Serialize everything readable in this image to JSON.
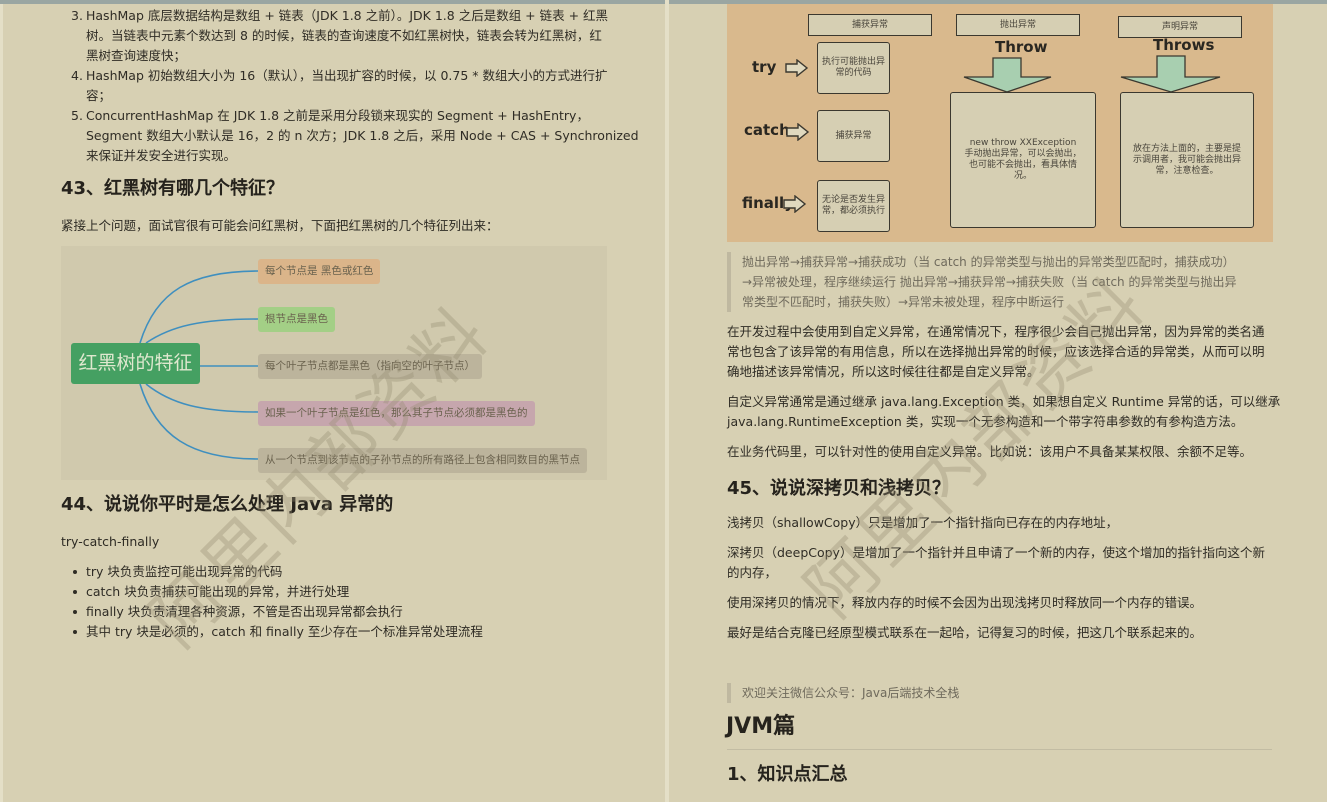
{
  "left_page": {
    "hashmap_list": [
      {
        "num": "3.",
        "lines": [
          "HashMap 底层数据结构是数组 + 链表（JDK 1.8 之前）。JDK 1.8 之后是数组 + 链表 + 红黑",
          "树。当链表中元素个数达到 8 的时候，链表的查询速度不如红黑树快，链表会转为红黑树，红",
          "黑树查询速度快；"
        ]
      },
      {
        "num": "4.",
        "lines": [
          "HashMap 初始数组大小为 16（默认），当出现扩容的时候，以 0.75 * 数组大小的方式进行扩",
          "容；"
        ]
      },
      {
        "num": "5.",
        "lines": [
          "ConcurrentHashMap 在 JDK 1.8 之前是采用分段锁来现实的 Segment + HashEntry，",
          "Segment 数组大小默认是 16，2 的 n 次方；JDK 1.8 之后，采用 Node + CAS + Synchronized",
          "来保证并发安全进行实现。"
        ]
      }
    ],
    "q43": {
      "title": "43、红黑树有哪几个特征？",
      "intro": "紧接上个问题，面试官很有可能会问红黑树，下面把红黑树的几个特征列出来："
    },
    "mindmap": {
      "root": "红黑树的特征",
      "line_color": "#3f8fbf",
      "nodes": [
        {
          "label": "每个节点是 黑色或红色",
          "color": "#dbb58a"
        },
        {
          "label": "根节点是黑色",
          "color": "#a3cf86"
        },
        {
          "label": "每个叶子节点都是黑色（指向空的叶子节点）",
          "color": "#bcb49c"
        },
        {
          "label": "如果一个叶子节点是红色，那么其子节点必须都是黑色的",
          "color": "#c6a6ad"
        },
        {
          "label": "从一个节点到该节点的子孙节点的所有路径上包含相同数目的黑节点",
          "color": "#bcb49c"
        }
      ]
    },
    "q44": {
      "title": "44、说说你平时是怎么处理 Java 异常的",
      "intro": "try-catch-finally",
      "bullets": [
        "try 块负责监控可能出现异常的代码",
        "catch 块负责捕获可能出现的异常，并进行处理",
        "finally 块负责清理各种资源，不管是否出现异常都会执行",
        "其中 try 块是必须的，catch 和 finally 至少存在一个标准异常处理流程"
      ]
    },
    "watermark": "阿里内部资料"
  },
  "right_page": {
    "diagram": {
      "headers": [
        "捕获异常",
        "抛出异常",
        "声明异常"
      ],
      "keywords": [
        "try",
        "catch",
        "finally"
      ],
      "blocks": [
        "执行可能抛出异常的代码",
        "捕获异常",
        "无论是否发生异常，都必须执行"
      ],
      "throw_label": "Throw",
      "throws_label": "Throws",
      "throw_desc": [
        "new throw XXException",
        "手动抛出异常，可以会抛出，",
        "也可能不会抛出，看具体情",
        "况。"
      ],
      "throws_desc": [
        "放在方法上面的，主要是提",
        "示调用者，我可能会抛出异",
        "常，注意检查。"
      ]
    },
    "quote": [
      "抛出异常→捕获异常→捕获成功（当 catch 的异常类型与抛出的异常类型匹配时，捕获成功）",
      "→异常被处理，程序继续运行 抛出异常→捕获异常→捕获失败（当 catch 的异常类型与抛出异",
      "常类型不匹配时，捕获失败）→异常未被处理，程序中断运行"
    ],
    "para1": [
      "在开发过程中会使用到自定义异常，在通常情况下，程序很少会自己抛出异常，因为异常的类名通",
      "常也包含了该异常的有用信息，所以在选择抛出异常的时候，应该选择合适的异常类，从而可以明",
      "确地描述该异常情况，所以这时候往往都是自定义异常。"
    ],
    "para2": [
      "自定义异常通常是通过继承 java.lang.Exception 类，如果想自定义 Runtime 异常的话，可以继承",
      "java.lang.RuntimeException 类，实现一个无参构造和一个带字符串参数的有参构造方法。"
    ],
    "para3": "在业务代码里，可以针对性的使用自定义异常。比如说：该用户不具备某某权限、余额不足等。",
    "q45": {
      "title": "45、说说深拷贝和浅拷贝？",
      "p1": "浅拷贝（shallowCopy）只是增加了一个指针指向已存在的内存地址，",
      "p2": [
        "深拷贝（deepCopy）是增加了一个指针并且申请了一个新的内存，使这个增加的指针指向这个新",
        "的内存，"
      ],
      "p3": "使用深拷贝的情况下，释放内存的时候不会因为出现浅拷贝时释放同一个内存的错误。",
      "p4": "最好是结合克隆已经原型模式联系在一起哈，记得复习的时候，把这几个联系起来的。"
    },
    "follow_quote": "欢迎关注微信公众号：Java后端技术全栈",
    "jvm_title": "JVM篇",
    "section1_title": "1、知识点汇总",
    "watermark": "阿里内部资料"
  }
}
